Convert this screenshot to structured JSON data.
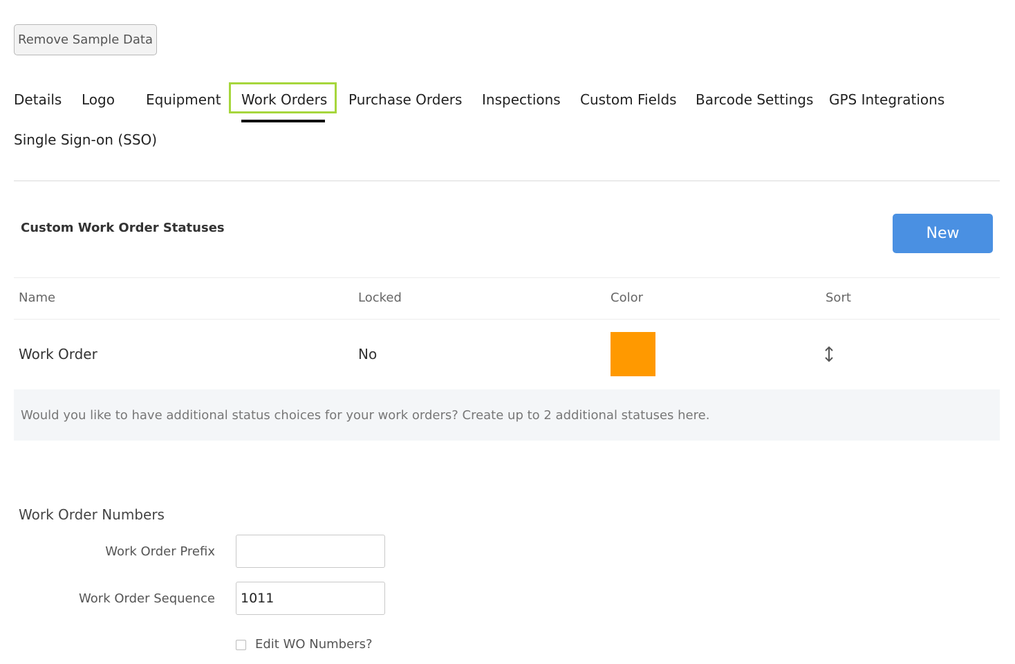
{
  "toolbar": {
    "remove_sample_label": "Remove Sample Data"
  },
  "tabs": [
    {
      "label": "Details"
    },
    {
      "label": "Logo"
    },
    {
      "label": "Equipment"
    },
    {
      "label": "Work Orders",
      "active": true
    },
    {
      "label": "Purchase Orders"
    },
    {
      "label": "Inspections"
    },
    {
      "label": "Custom Fields"
    },
    {
      "label": "Barcode Settings"
    },
    {
      "label": "GPS Integrations"
    },
    {
      "label": "Single Sign-on (SSO)"
    }
  ],
  "statuses": {
    "title": "Custom Work Order Statuses",
    "new_label": "New",
    "columns": [
      "Name",
      "Locked",
      "Color",
      "Sort"
    ],
    "rows": [
      {
        "name": "Work Order",
        "locked": "No",
        "color": "#ff9900",
        "sort_icon": "sort-arrows-icon"
      }
    ],
    "info": "Would you like to have additional status choices for your work orders? Create up to 2 additional statuses here."
  },
  "numbers": {
    "heading": "Work Order Numbers",
    "prefix_label": "Work Order Prefix",
    "prefix_value": "",
    "sequence_label": "Work Order Sequence",
    "sequence_value": "1011",
    "edit_label": "Edit WO Numbers?",
    "edit_checked": false
  },
  "colors": {
    "accent": "#4a90e2",
    "tab_highlight": "#a6d63c"
  }
}
